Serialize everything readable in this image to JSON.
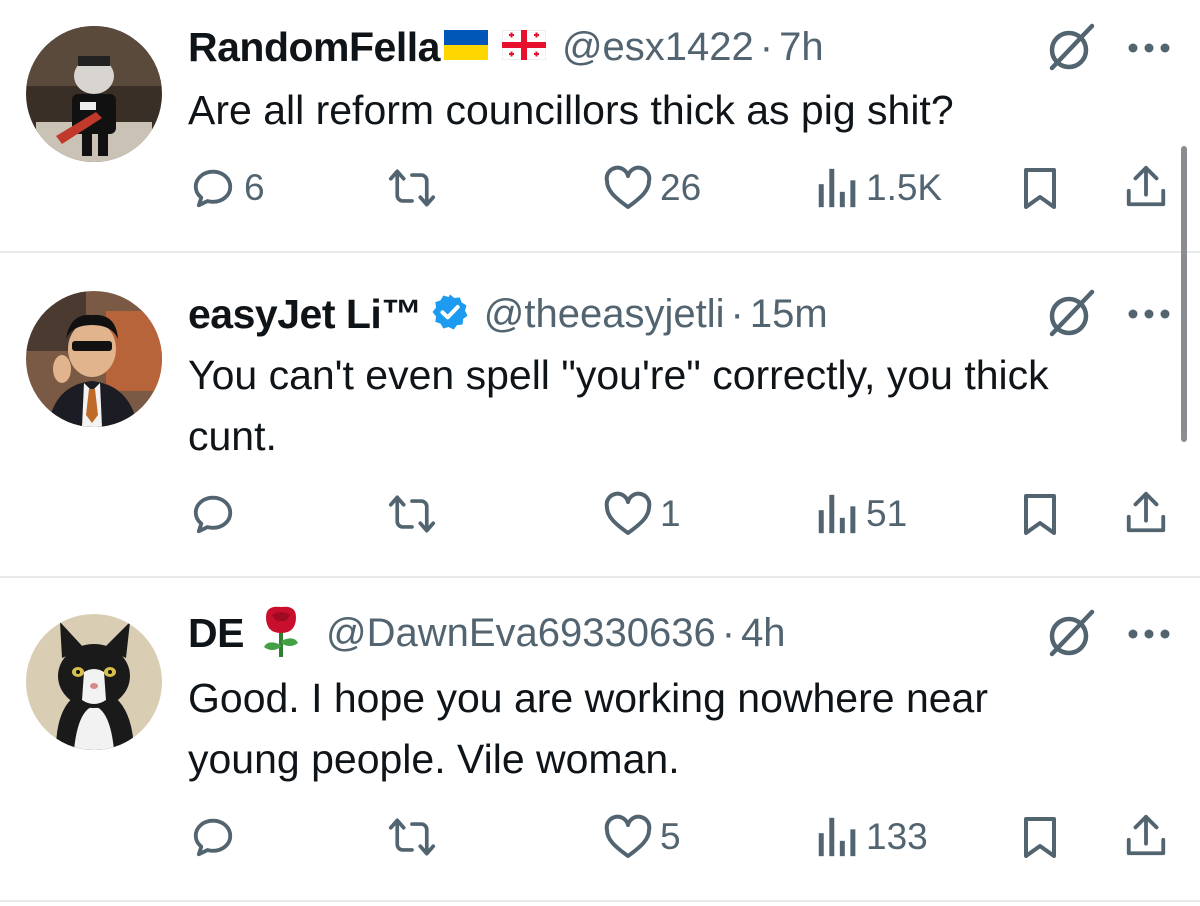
{
  "tweets": [
    {
      "display_name": "RandomFella",
      "handle": "@esx1422",
      "separator": "·",
      "time": "7h",
      "text": "Are all reform councillors thick as pig shit?",
      "replies": "6",
      "retweets": "",
      "likes": "26",
      "views": "1.5K",
      "avatar_icon": "guitarist-avatar",
      "name_icons": [
        "ukraine-flag-icon",
        "georgia-flag-icon"
      ]
    },
    {
      "display_name": "easyJet Li™",
      "handle": "@theeasyjetli",
      "separator": "·",
      "time": "15m",
      "text": "You can't even spell \"you're\" correctly, you thick cunt.",
      "replies": "",
      "retweets": "",
      "likes": "1",
      "views": "51",
      "avatar_icon": "man-with-sunglasses-avatar",
      "name_icons": [
        "verified-badge-icon"
      ]
    },
    {
      "display_name": "DE",
      "handle": "@DawnEva69330636",
      "separator": "·",
      "time": "4h",
      "text": "Good. I hope you are working nowhere near young people. Vile woman.",
      "replies": "",
      "retweets": "",
      "likes": "5",
      "views": "133",
      "avatar_icon": "cat-avatar",
      "name_icons": [
        "rose-icon"
      ]
    }
  ],
  "colors": {
    "text": "#0f1419",
    "secondary": "#536471",
    "divider": "#e7e9ea",
    "verified": "#1d9bf0",
    "ukraine_blue": "#0057b8",
    "ukraine_yellow": "#ffd700",
    "georgia_red": "#e8112d",
    "rose_red": "#c8102e"
  }
}
